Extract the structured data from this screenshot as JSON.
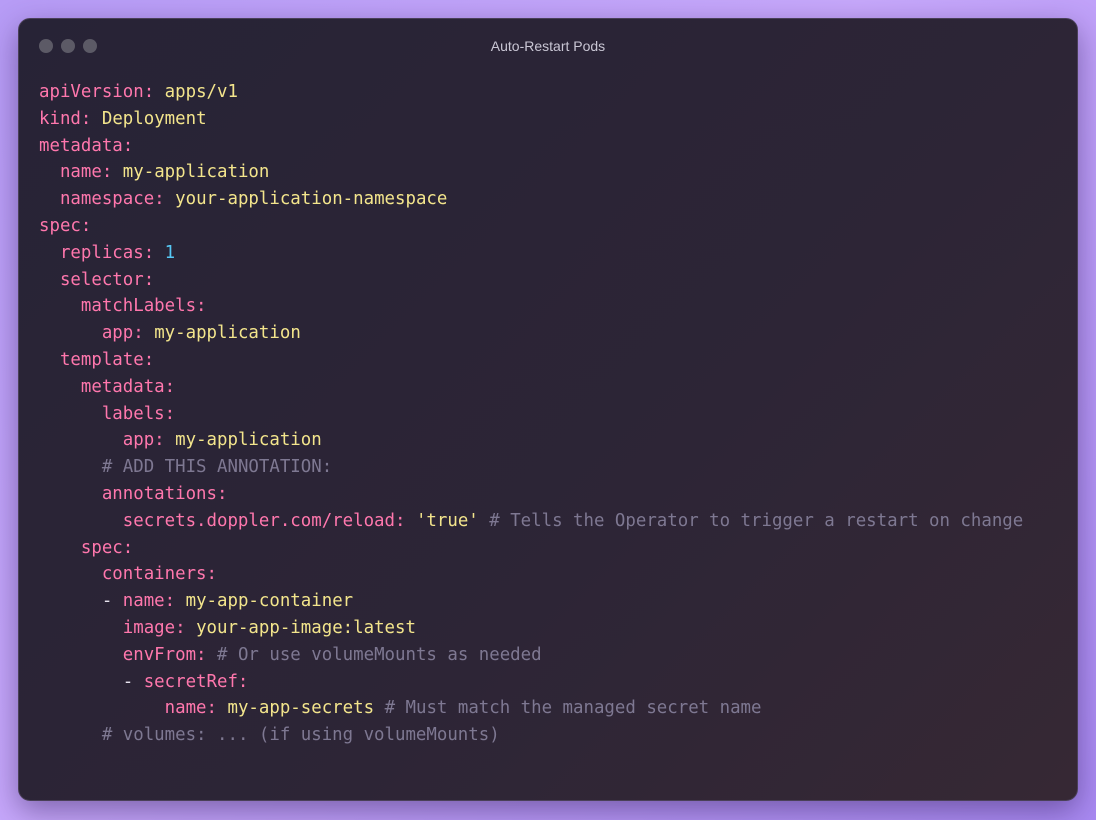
{
  "window": {
    "title": "Auto-Restart Pods",
    "controls": [
      "close",
      "minimize",
      "zoom"
    ]
  },
  "colors": {
    "key": "#ff77ad",
    "value": "#f3e58c",
    "number": "#56c8f5",
    "comment": "#7e7892",
    "window_bg": "#272336",
    "page_bg": "#b79cf6"
  },
  "lines": [
    [
      {
        "t": "k",
        "s": "apiVersion:"
      },
      {
        "t": "p",
        "s": " "
      },
      {
        "t": "v",
        "s": "apps/v1"
      }
    ],
    [
      {
        "t": "k",
        "s": "kind:"
      },
      {
        "t": "p",
        "s": " "
      },
      {
        "t": "v",
        "s": "Deployment"
      }
    ],
    [
      {
        "t": "k",
        "s": "metadata:"
      }
    ],
    [
      {
        "t": "p",
        "s": "  "
      },
      {
        "t": "k",
        "s": "name:"
      },
      {
        "t": "p",
        "s": " "
      },
      {
        "t": "v",
        "s": "my-application"
      }
    ],
    [
      {
        "t": "p",
        "s": "  "
      },
      {
        "t": "k",
        "s": "namespace:"
      },
      {
        "t": "p",
        "s": " "
      },
      {
        "t": "v",
        "s": "your-application-namespace"
      }
    ],
    [
      {
        "t": "k",
        "s": "spec:"
      }
    ],
    [
      {
        "t": "p",
        "s": "  "
      },
      {
        "t": "k",
        "s": "replicas:"
      },
      {
        "t": "p",
        "s": " "
      },
      {
        "t": "n",
        "s": "1"
      }
    ],
    [
      {
        "t": "p",
        "s": "  "
      },
      {
        "t": "k",
        "s": "selector:"
      }
    ],
    [
      {
        "t": "p",
        "s": "    "
      },
      {
        "t": "k",
        "s": "matchLabels:"
      }
    ],
    [
      {
        "t": "p",
        "s": "      "
      },
      {
        "t": "k",
        "s": "app:"
      },
      {
        "t": "p",
        "s": " "
      },
      {
        "t": "v",
        "s": "my-application"
      }
    ],
    [
      {
        "t": "p",
        "s": "  "
      },
      {
        "t": "k",
        "s": "template:"
      }
    ],
    [
      {
        "t": "p",
        "s": "    "
      },
      {
        "t": "k",
        "s": "metadata:"
      }
    ],
    [
      {
        "t": "p",
        "s": "      "
      },
      {
        "t": "k",
        "s": "labels:"
      }
    ],
    [
      {
        "t": "p",
        "s": "        "
      },
      {
        "t": "k",
        "s": "app:"
      },
      {
        "t": "p",
        "s": " "
      },
      {
        "t": "v",
        "s": "my-application"
      }
    ],
    [
      {
        "t": "p",
        "s": "      "
      },
      {
        "t": "c",
        "s": "# ADD THIS ANNOTATION:"
      }
    ],
    [
      {
        "t": "p",
        "s": "      "
      },
      {
        "t": "k",
        "s": "annotations:"
      }
    ],
    [
      {
        "t": "p",
        "s": "        "
      },
      {
        "t": "k",
        "s": "secrets.doppler.com/reload:"
      },
      {
        "t": "p",
        "s": " "
      },
      {
        "t": "v",
        "s": "'true'"
      },
      {
        "t": "p",
        "s": " "
      },
      {
        "t": "c",
        "s": "# Tells the Operator to trigger a restart on change"
      }
    ],
    [
      {
        "t": "p",
        "s": "    "
      },
      {
        "t": "k",
        "s": "spec:"
      }
    ],
    [
      {
        "t": "p",
        "s": "      "
      },
      {
        "t": "k",
        "s": "containers:"
      }
    ],
    [
      {
        "t": "p",
        "s": "      - "
      },
      {
        "t": "k",
        "s": "name:"
      },
      {
        "t": "p",
        "s": " "
      },
      {
        "t": "v",
        "s": "my-app-container"
      }
    ],
    [
      {
        "t": "p",
        "s": "        "
      },
      {
        "t": "k",
        "s": "image:"
      },
      {
        "t": "p",
        "s": " "
      },
      {
        "t": "v",
        "s": "your-app-image:latest"
      }
    ],
    [
      {
        "t": "p",
        "s": "        "
      },
      {
        "t": "k",
        "s": "envFrom:"
      },
      {
        "t": "p",
        "s": " "
      },
      {
        "t": "c",
        "s": "# Or use volumeMounts as needed"
      }
    ],
    [
      {
        "t": "p",
        "s": "        - "
      },
      {
        "t": "k",
        "s": "secretRef:"
      }
    ],
    [
      {
        "t": "p",
        "s": "            "
      },
      {
        "t": "k",
        "s": "name:"
      },
      {
        "t": "p",
        "s": " "
      },
      {
        "t": "v",
        "s": "my-app-secrets"
      },
      {
        "t": "p",
        "s": " "
      },
      {
        "t": "c",
        "s": "# Must match the managed secret name"
      }
    ],
    [
      {
        "t": "p",
        "s": "      "
      },
      {
        "t": "c",
        "s": "# volumes: ... (if using volumeMounts)"
      }
    ]
  ]
}
